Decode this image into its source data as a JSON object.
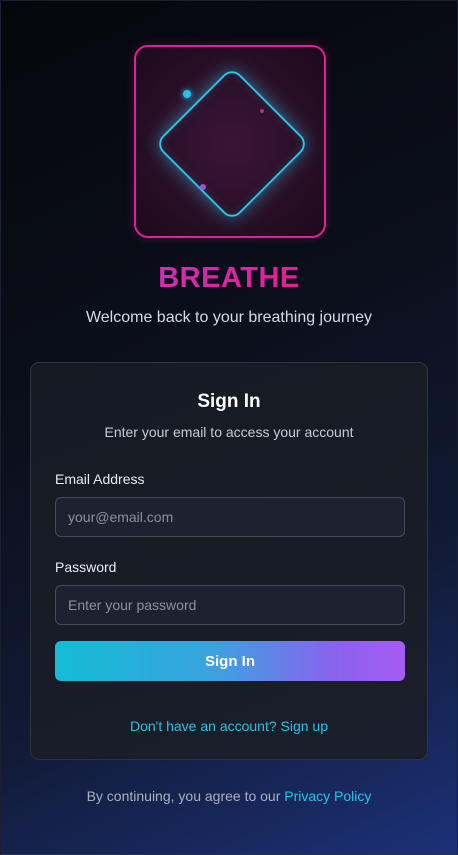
{
  "brand": {
    "name": "BREATHE",
    "tagline": "Welcome back to your breathing journey"
  },
  "signin_card": {
    "title": "Sign In",
    "description": "Enter your email to access your account",
    "email": {
      "label": "Email Address",
      "value": "",
      "placeholder": "your@email.com"
    },
    "password": {
      "label": "Password",
      "value": "",
      "placeholder": "Enter your password"
    },
    "submit_label": "Sign In",
    "signup_link": "Don't have an account? Sign up"
  },
  "footer": {
    "text": "By continuing, you agree to our",
    "policy_link": "Privacy Policy"
  },
  "colors": {
    "brand_pink": "#e0209a",
    "accent_cyan": "#22c3e6",
    "button_gradient_start": "#14bcd6",
    "button_gradient_end": "#a55cf4"
  },
  "icons": {
    "logo": "breathe-diamond-logo"
  }
}
